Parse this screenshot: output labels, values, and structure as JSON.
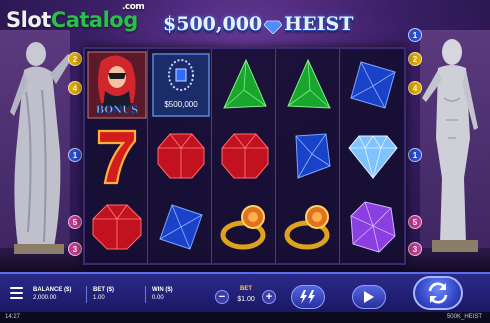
{
  "brand": {
    "slot": "Slot",
    "catalog": "Catalog",
    "dotcom": ".com"
  },
  "game": {
    "title_part1": "$500,000",
    "title_part2": "HEIST"
  },
  "reels": [
    [
      "bonus-woman",
      "seven",
      "ruby"
    ],
    [
      "sapphire-necklace",
      "ruby",
      "sapphire"
    ],
    [
      "emerald-triangle",
      "ruby",
      "gold-ring"
    ],
    [
      "emerald-triangle",
      "sapphire",
      "gold-ring"
    ],
    [
      "sapphire",
      "diamond",
      "amethyst"
    ]
  ],
  "symbol_labels": {
    "bonus": "BONUS",
    "necklace_value": "$500,000"
  },
  "paylines": {
    "left": [
      "2",
      "4",
      "1",
      "5",
      "3"
    ],
    "right": [
      "1",
      "2",
      "4",
      "1",
      "5",
      "3"
    ]
  },
  "controls": {
    "balance_label": "BALANCE ($)",
    "balance_value": "2,000.00",
    "bet_label": "BET ($)",
    "bet_value": "1.00",
    "win_label": "WIN ($)",
    "win_value": "0.00",
    "bet_title": "BET",
    "bet_amount": "$1.00",
    "minus": "−",
    "plus": "+"
  },
  "status": {
    "time": "14:27",
    "game_id": "500K_HEIST"
  },
  "colors": {
    "accent": "#5366e0",
    "bet_title": "#ffc93b",
    "brand_green": "#27c04a"
  }
}
